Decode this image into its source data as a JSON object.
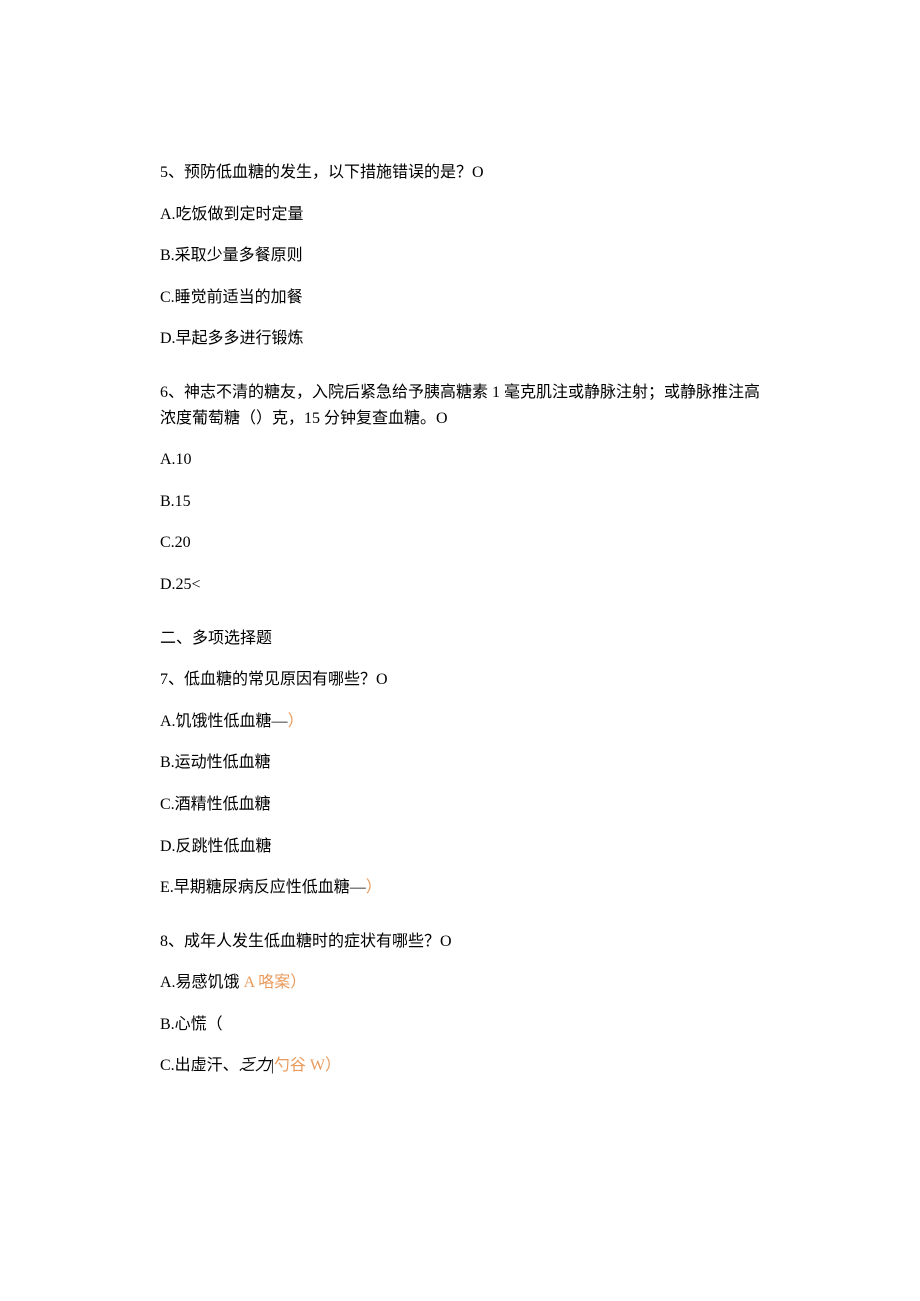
{
  "q5": {
    "text": "5、预防低血糖的发生，以下措施错误的是？O",
    "options": {
      "a": "A.吃饭做到定时定量",
      "b": "B.采取少量多餐原则",
      "c": "C.睡觉前适当的加餐",
      "d": "D.早起多多进行锻炼"
    }
  },
  "q6": {
    "text": "6、神志不清的糖友，入院后紧急给予胰高糖素 1 毫克肌注或静脉注射；或静脉推注高浓度葡萄糖（）克，15 分钟复查血糖。O",
    "options": {
      "a": "A.10",
      "b": "B.15",
      "c": "C.20",
      "d": "D.25<"
    }
  },
  "section2": "二、多项选择题",
  "q7": {
    "text": "7、低血糖的常见原因有哪些？O",
    "options": {
      "a": "A.饥饿性低血糖—",
      "a_mark": "）",
      "b": "B.运动性低血糖",
      "c": "C.酒精性低血糖",
      "d": "D.反跳性低血糖",
      "e": "E.早期糖尿病反应性低血糖—",
      "e_mark": "）"
    }
  },
  "q8": {
    "text": "8、成年人发生低血糖时的症状有哪些？O",
    "options": {
      "a": "A.易感饥饿 ",
      "a_mark": "A 咯案）",
      "b": "B.心慌（",
      "c_prefix": "C.出虚汗、",
      "c_italic": "乏力",
      "c_sep": "|",
      "c_mark": "勺谷 W）"
    }
  }
}
